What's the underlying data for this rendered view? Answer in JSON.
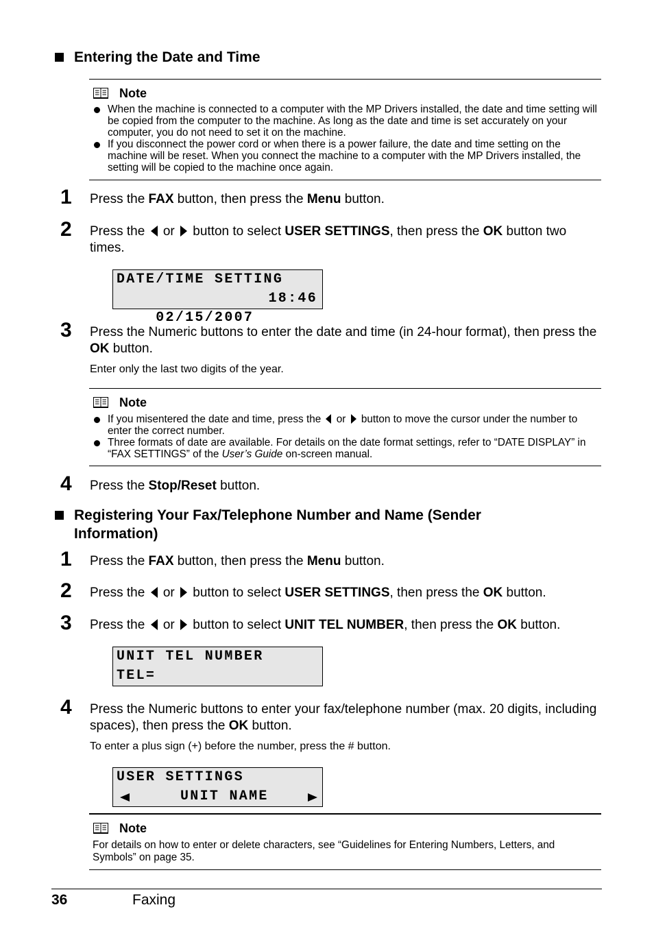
{
  "sections": [
    {
      "title": "Entering the Date and Time",
      "note1": {
        "label": "Note",
        "items": [
          "When the machine is connected to a computer with the MP Drivers installed, the date and time setting will be copied from the computer to the machine. As long as the date and time is set accurately on your computer, you do not need to set it on the machine.",
          "If you disconnect the power cord or when there is a power failure, the date and time setting on the machine will be reset. When you connect the machine to a computer with the MP Drivers installed, the setting will be copied to the machine once again."
        ]
      },
      "steps": [
        {
          "num": "1",
          "parts": {
            "a": "Press the ",
            "b1": "FAX",
            "c": " button, then press the ",
            "b2": "Menu",
            "d": " button."
          }
        },
        {
          "num": "2",
          "parts": {
            "a": "Press the ",
            "or": " or ",
            "c": " button to select ",
            "b1": "USER SETTINGS",
            "d": ", then press the ",
            "b2": "OK",
            "e": " button two times."
          },
          "lcd": {
            "line1": "DATE/TIME SETTING",
            "date": "02/15/2007",
            "time": "18:46"
          }
        },
        {
          "num": "3",
          "parts": {
            "a": "Press the Numeric buttons to enter the date and time (in 24-hour format), then press the ",
            "b1": "OK",
            "c": " button."
          },
          "sub": "Enter only the last two digits of the year."
        },
        {
          "num": "4",
          "parts": {
            "a": "Press the ",
            "b1": "Stop/Reset",
            "c": " button."
          }
        }
      ],
      "note2": {
        "label": "Note",
        "item1": {
          "a": "If you misentered the date and time, press the ",
          "or": " or ",
          "b": " button to move the cursor under the number to enter the correct number."
        },
        "item2": {
          "a": "Three formats of date are available. For details on the date format settings, refer to “DATE DISPLAY” in “FAX SETTINGS” of the ",
          "i": "User’s Guide",
          "b": " on-screen manual."
        }
      }
    },
    {
      "title": "Registering Your Fax/Telephone Number and Name (Sender Information)",
      "steps": [
        {
          "num": "1",
          "parts": {
            "a": "Press the ",
            "b1": "FAX",
            "c": " button, then press the ",
            "b2": "Menu",
            "d": " button."
          }
        },
        {
          "num": "2",
          "parts": {
            "a": "Press the ",
            "or": " or ",
            "c": " button to select ",
            "b1": "USER SETTINGS",
            "d": ", then press the ",
            "b2": "OK",
            "e": " button."
          }
        },
        {
          "num": "3",
          "parts": {
            "a": "Press the ",
            "or": " or ",
            "c": " button to select ",
            "b1": "UNIT TEL NUMBER",
            "d": ", then press the ",
            "b2": "OK",
            "e": " button."
          },
          "lcd": {
            "line1": "UNIT TEL NUMBER",
            "line2": "TEL="
          }
        },
        {
          "num": "4",
          "parts": {
            "a": "Press the Numeric buttons to enter your fax/telephone number (max. 20 digits, including spaces), then press the ",
            "b1": "OK",
            "c": " button."
          },
          "sub": "To enter a plus sign (+) before the number, press the # button.",
          "lcd": {
            "line1": "USER SETTINGS",
            "center": "UNIT NAME"
          }
        }
      ],
      "note": {
        "label": "Note",
        "text": "For details on how to enter or delete characters, see “Guidelines for Entering Numbers, Letters, and Symbols” on page 35."
      }
    }
  ],
  "footer": {
    "page": "36",
    "chapter": "Faxing"
  }
}
